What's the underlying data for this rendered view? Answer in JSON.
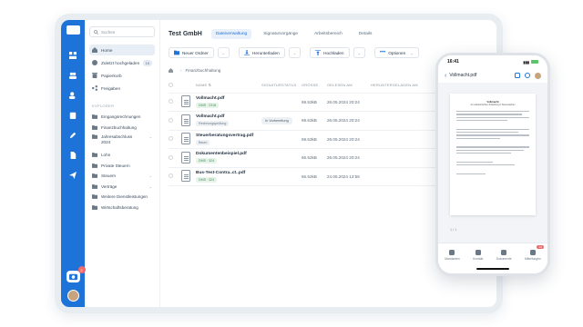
{
  "sidebar": {
    "search_placeholder": "Suchen",
    "nav": [
      {
        "label": "Home"
      },
      {
        "label": "Zuletzt hochgeladen",
        "count": "15"
      },
      {
        "label": "Papierkorb"
      },
      {
        "label": "Freigaben"
      }
    ],
    "explorer_label": "EXPLORER",
    "folders": [
      {
        "label": "Eingangsrechnungen",
        "chev": ""
      },
      {
        "label": "Finanzbuchhaltung",
        "chev": ""
      },
      {
        "label": "Jahresabschluss 2024",
        "chev": "⌄"
      },
      {
        "label": "Lohn",
        "chev": ""
      },
      {
        "label": "Private Steuern",
        "chev": ""
      },
      {
        "label": "Steuern",
        "chev": "⌄"
      },
      {
        "label": "Verträge",
        "chev": "⌄"
      },
      {
        "label": "Weitere Dienstleistungen",
        "chev": ""
      },
      {
        "label": "Wirtschaftsberatung",
        "chev": ""
      }
    ]
  },
  "rail": {
    "badge": "2"
  },
  "header": {
    "company": "Test GmbH",
    "tabs": [
      "Dateiverwaltung",
      "Signaturvorgänge",
      "Arbeitsbereich",
      "Details"
    ]
  },
  "toolbar": {
    "new_folder": "Neuer Ordner",
    "download": "Herunterladen",
    "upload": "Hochladen",
    "options": "Optionen"
  },
  "breadcrumb": {
    "current": "Finanzbuchhaltung"
  },
  "table": {
    "columns": [
      "NAME",
      "SIGNATURSTATUS",
      "GRÖSSE",
      "GELESEN AM",
      "HERUNTERGELADEN AM"
    ],
    "rows": [
      {
        "name": "Vollmacht.pdf",
        "tag": "DMS · 2318",
        "tag_style": "green",
        "status": "",
        "size": "69.53kB",
        "read": "26.05.2024 20:24",
        "downloaded": ""
      },
      {
        "name": "Vollmacht.pdf",
        "tag": "Rechnungsprüfung",
        "tag_style": "grey",
        "status": "In Vorbereitung",
        "size": "69.53kB",
        "read": "26.05.2024 20:24",
        "downloaded": ""
      },
      {
        "name": "Steuerberatungsvertrag.pdf",
        "tag": "Baum",
        "tag_style": "grey",
        "status": "",
        "size": "69.53kB",
        "read": "26.05.2024 20:24",
        "downloaded": ""
      },
      {
        "name": "Dokumentenbeispiel.pdf",
        "tag": "DMS · 324",
        "tag_style": "green",
        "status": "",
        "size": "66.52kB",
        "read": "26.05.2024 20:24",
        "downloaded": ""
      },
      {
        "name": "Bus-Test-Contra..ct..pdf",
        "tag": "DMS · 324",
        "tag_style": "green",
        "status": "",
        "size": "66.52kB",
        "read": "24.05.2024 12:56",
        "downloaded": ""
      }
    ]
  },
  "phone": {
    "time": "16:41",
    "title": "Vollmacht.pdf",
    "back": "‹",
    "doc_title": "Vollmacht",
    "doc_subtitle": "zur elektronischen Zustellung in Steuersachen",
    "page_indicator": "1 / 1",
    "tabs": [
      {
        "label": "Mandanten",
        "badge": ""
      },
      {
        "label": "Kontakt",
        "badge": ""
      },
      {
        "label": "Dokumente",
        "badge": ""
      },
      {
        "label": "Mitteilungen",
        "badge": "10"
      }
    ]
  }
}
